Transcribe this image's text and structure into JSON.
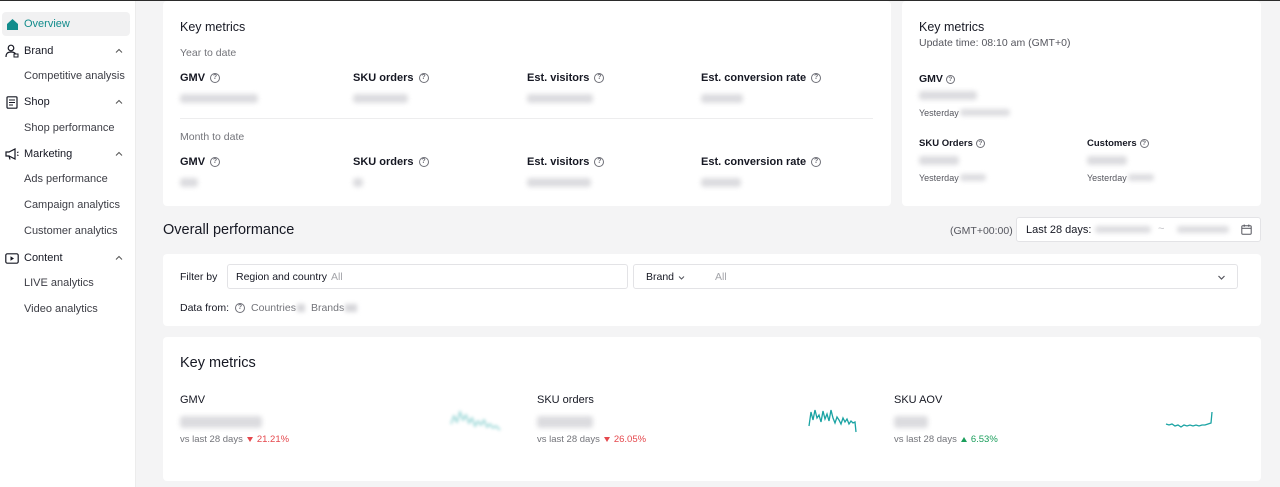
{
  "sidebar": {
    "overview": "Overview",
    "brand": "Brand",
    "brand_items": [
      "Competitive analysis"
    ],
    "shop": "Shop",
    "shop_items": [
      "Shop performance"
    ],
    "marketing": "Marketing",
    "marketing_items": [
      "Ads performance",
      "Campaign analytics",
      "Customer analytics"
    ],
    "content": "Content",
    "content_items": [
      "LIVE analytics",
      "Video analytics"
    ]
  },
  "key_metrics_card": {
    "title": "Key metrics",
    "ytd_label": "Year to date",
    "mtd_label": "Month to date",
    "columns": [
      "GMV",
      "SKU orders",
      "Est. visitors",
      "Est. conversion rate"
    ]
  },
  "realtime_card": {
    "title": "Key metrics",
    "update_time": "Update time: 08:10 am (GMT+0)",
    "gmv_label": "GMV",
    "yesterday": "Yesterday",
    "sku_orders_label": "SKU Orders",
    "customers_label": "Customers"
  },
  "overall": {
    "title": "Overall performance",
    "timezone": "(GMT+00:00)",
    "date_range_label": "Last 28 days:"
  },
  "filters": {
    "filter_by": "Filter by",
    "region_label": "Region and country",
    "region_value": "All",
    "brand_label": "Brand",
    "brand_value": "All",
    "data_from": "Data from:",
    "countries": "Countries",
    "brands": "Brands"
  },
  "key_metrics_2": {
    "title": "Key metrics",
    "metrics": [
      {
        "label": "GMV",
        "compare": "vs last 28 days",
        "change": "21.21%",
        "direction": "down"
      },
      {
        "label": "SKU orders",
        "compare": "vs last 28 days",
        "change": "26.05%",
        "direction": "down"
      },
      {
        "label": "SKU AOV",
        "compare": "vs last 28 days",
        "change": "6.53%",
        "direction": "up"
      }
    ]
  },
  "colors": {
    "accent": "#128c8c",
    "sparkline": "#1aa3a3",
    "down": "#e5484d",
    "up": "#1a9e5b"
  }
}
